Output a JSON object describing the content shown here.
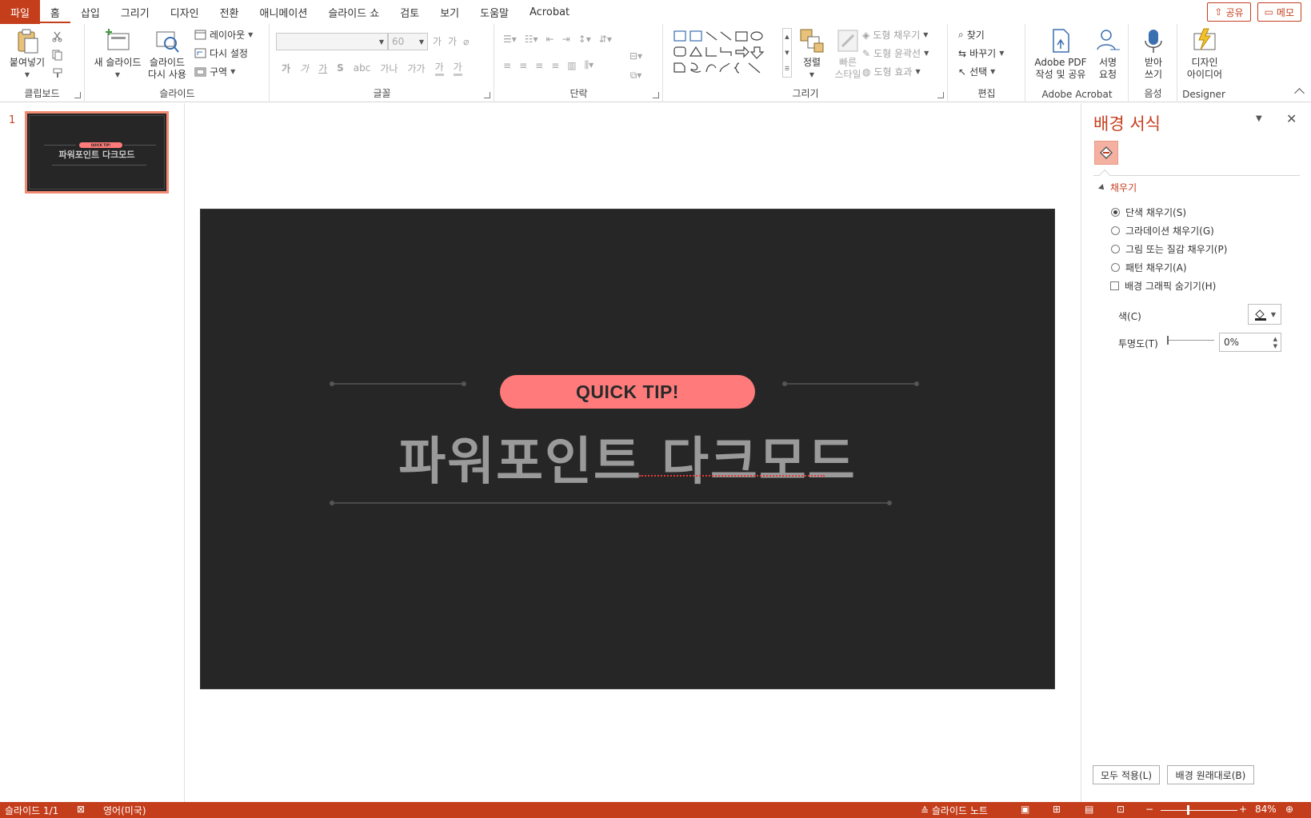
{
  "menu": {
    "tabs": [
      "파일",
      "홈",
      "삽입",
      "그리기",
      "디자인",
      "전환",
      "애니메이션",
      "슬라이드 쇼",
      "검토",
      "보기",
      "도움말",
      "Acrobat"
    ],
    "share_label": "공유",
    "comment_label": "메모"
  },
  "ribbon": {
    "clipboard": {
      "paste_label": "붙여넣기",
      "group_label": "클립보드"
    },
    "slides": {
      "new_slide_label": "새 슬라이드",
      "reuse_label_1": "슬라이드",
      "reuse_label_2": "다시 사용",
      "layout_label": "레이아웃",
      "reset_label": "다시 설정",
      "section_label": "구역",
      "group_label": "슬라이드"
    },
    "font": {
      "font_name": "",
      "font_size": "60",
      "grow_label": "가",
      "shrink_label": "가",
      "bold": "가",
      "italic": "가",
      "underline": "가",
      "strike": "S",
      "spacing": "가나",
      "case": "가가",
      "highlight": "가",
      "fontcolor": "가",
      "group_label": "글꼴"
    },
    "paragraph": {
      "group_label": "단락"
    },
    "drawing": {
      "arrange_label": "정렬",
      "quickstyle_label_1": "빠른",
      "quickstyle_label_2": "스타일",
      "shape_fill_label": "도형 채우기",
      "shape_outline_label": "도형 윤곽선",
      "shape_effect_label": "도형 효과",
      "group_label": "그리기"
    },
    "editing": {
      "find_label": "찾기",
      "replace_label": "바꾸기",
      "select_label": "선택",
      "group_label": "편집"
    },
    "acrobat": {
      "create_pdf_label_1": "Adobe PDF",
      "create_pdf_label_2": "작성 및 공유",
      "request_sign_label_1": "서명",
      "request_sign_label_2": "요청",
      "group_label": "Adobe Acrobat"
    },
    "voice": {
      "dictate_label_1": "받아",
      "dictate_label_2": "쓰기",
      "group_label": "음성"
    },
    "designer": {
      "ideas_label_1": "디자인",
      "ideas_label_2": "아이디어",
      "group_label": "Designer"
    }
  },
  "thumbnails": [
    {
      "number": "1",
      "pill_text": "QUICK TIP!",
      "title": "파워포인트 다크모드"
    }
  ],
  "slide": {
    "pill_text": "QUICK TIP!",
    "title": "파워포인트 다크모드",
    "background_color": "#262626",
    "accent_color": "#ff7b7b"
  },
  "format_pane": {
    "title": "배경 서식",
    "section_title": "채우기",
    "options": [
      {
        "label": "단색 채우기(S)",
        "selected": true
      },
      {
        "label": "그라데이션 채우기(G)",
        "selected": false
      },
      {
        "label": "그림 또는 질감 채우기(P)",
        "selected": false
      },
      {
        "label": "패턴 채우기(A)",
        "selected": false
      }
    ],
    "hide_graphics_label": "배경 그래픽 숨기기(H)",
    "color_label": "색(C)",
    "transparency_label": "투명도(T)",
    "transparency_value": "0%",
    "apply_all_label": "모두 적용(L)",
    "reset_background_label": "배경 원래대로(B)"
  },
  "status": {
    "slide_counter": "슬라이드 1/1",
    "language": "영어(미국)",
    "notes_label": "슬라이드 노트",
    "zoom": "84%"
  },
  "colors": {
    "brand": "#c43e1c"
  }
}
